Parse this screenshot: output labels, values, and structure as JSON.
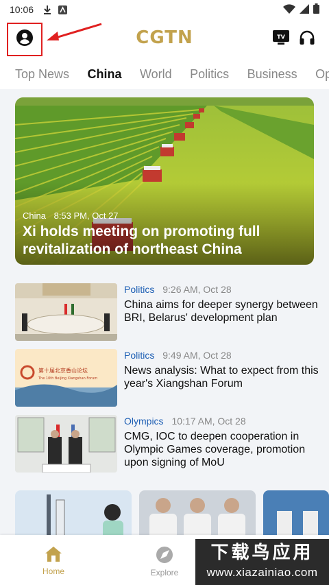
{
  "status_bar": {
    "time": "10:06"
  },
  "header": {
    "logo": "CGTN",
    "tv_label": "TV"
  },
  "tabs": [
    {
      "label": "Top News"
    },
    {
      "label": "China"
    },
    {
      "label": "World"
    },
    {
      "label": "Politics"
    },
    {
      "label": "Business"
    },
    {
      "label": "Op"
    }
  ],
  "hero": {
    "category": "China",
    "time": "8:53 PM, Oct 27",
    "headline": "Xi holds meeting on promoting full revitalization of northeast China"
  },
  "articles": [
    {
      "category": "Politics",
      "time": "9:26 AM, Oct 28",
      "title": "China aims for deeper synergy between BRI, Belarus' development plan"
    },
    {
      "category": "Politics",
      "time": "9:49 AM, Oct 28",
      "title": "News analysis: What to expect from this year's Xiangshan Forum",
      "thumb_cn": "第十届北京香山论坛",
      "thumb_en": "The 10th Beijing Xiangshan Forum"
    },
    {
      "category": "Olympics",
      "time": "10:17 AM, Oct 28",
      "title": "CMG, IOC to deepen cooperation in Olympic Games coverage, promotion upon signing of MoU"
    }
  ],
  "bottom_nav": [
    {
      "label": "Home"
    },
    {
      "label": "Explore"
    }
  ],
  "watermark": {
    "top": "下载鸟应用",
    "bottom": "www.xiazainiao.com"
  },
  "colors": {
    "brand_gold": "#c2a24d",
    "category_blue": "#1e5fb4",
    "highlight_red": "#e02020"
  }
}
